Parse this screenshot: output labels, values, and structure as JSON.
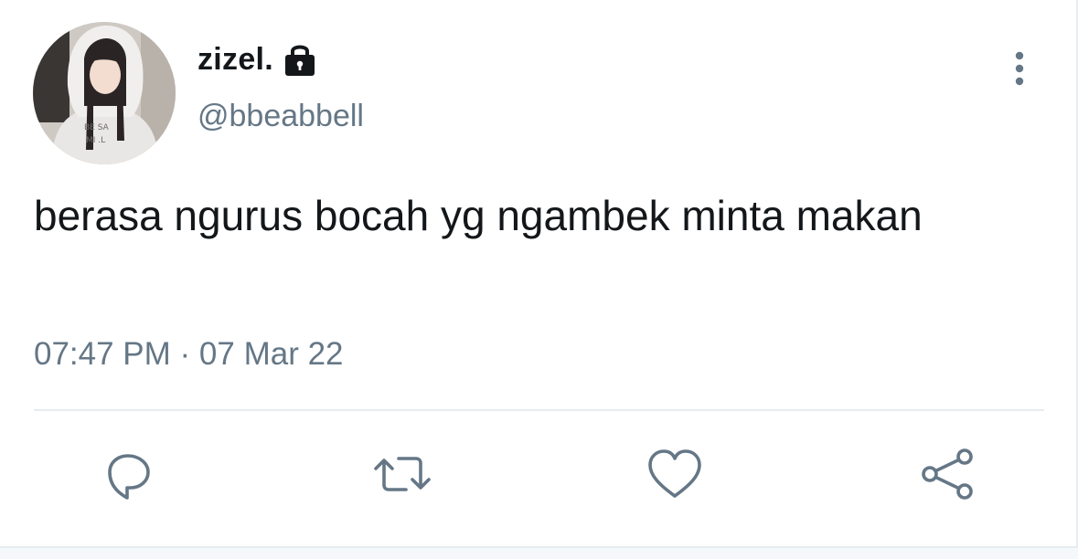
{
  "tweet": {
    "display_name": "zizel.",
    "handle": "@bbeabbell",
    "text": "berasa ngurus bocah yg ngambek minta makan",
    "timestamp": "07:47 PM · 07 Mar 22"
  },
  "icons": {
    "protected": "lock-icon",
    "more": "more-vertical-icon",
    "reply": "reply-icon",
    "retweet": "retweet-icon",
    "like": "heart-icon",
    "share": "share-icon"
  },
  "colors": {
    "primary_text": "#14171a",
    "secondary_text": "#657786",
    "divider": "#e6ecf0"
  }
}
